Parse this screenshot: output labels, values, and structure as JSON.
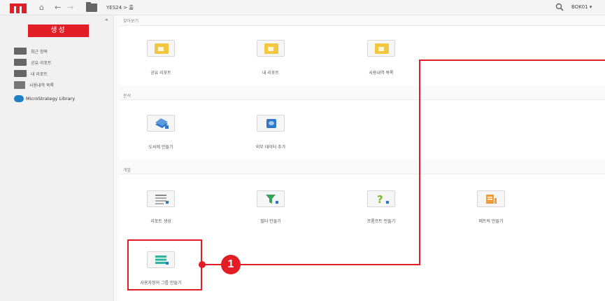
{
  "topbar": {
    "breadcrumb": "YES24 > 홈",
    "user": "BOK01 ▾",
    "home_glyph": "⌂",
    "back_glyph": "←",
    "forward_glyph": "→"
  },
  "sidebar": {
    "collapse_glyph": "◂",
    "create_label": "생성",
    "items": [
      {
        "label": "최근 항목",
        "icon": "recent-folder-icon"
      },
      {
        "label": "공유 리포트",
        "icon": "shared-folder-icon"
      },
      {
        "label": "내 리포트",
        "icon": "my-folder-icon"
      },
      {
        "label": "사용내역 목록",
        "icon": "history-icon"
      },
      {
        "label": "MicroStrategy Library",
        "icon": "library-icon"
      }
    ]
  },
  "sections": {
    "browse": {
      "title": "찾아보기",
      "tiles": [
        {
          "label": "공유 리포트"
        },
        {
          "label": "내 리포트"
        },
        {
          "label": "사용내역 목록"
        }
      ]
    },
    "analysis": {
      "title": "분석",
      "tiles": [
        {
          "label": "도씨에 만들기"
        },
        {
          "label": "외부 데이터 추가"
        }
      ]
    },
    "develop": {
      "title": "개발",
      "tiles": [
        {
          "label": "리포트 생성"
        },
        {
          "label": "필터 만들기"
        },
        {
          "label": "프롬프트 만들기"
        },
        {
          "label": "메트릭 만들기"
        },
        {
          "label": "사용자정의 그룹 만들기"
        }
      ]
    }
  },
  "annotation": {
    "badge": "1",
    "color": "#e31d25"
  },
  "colors": {
    "brand_red": "#e31d25",
    "folder_yellow": "#f3c73f",
    "filter_green": "#3aa35c",
    "prompt_green": "#7cb82f",
    "metric_orange": "#f29b2e",
    "group_teal": "#2bb5a0",
    "doc_blue": "#2f77c8"
  }
}
